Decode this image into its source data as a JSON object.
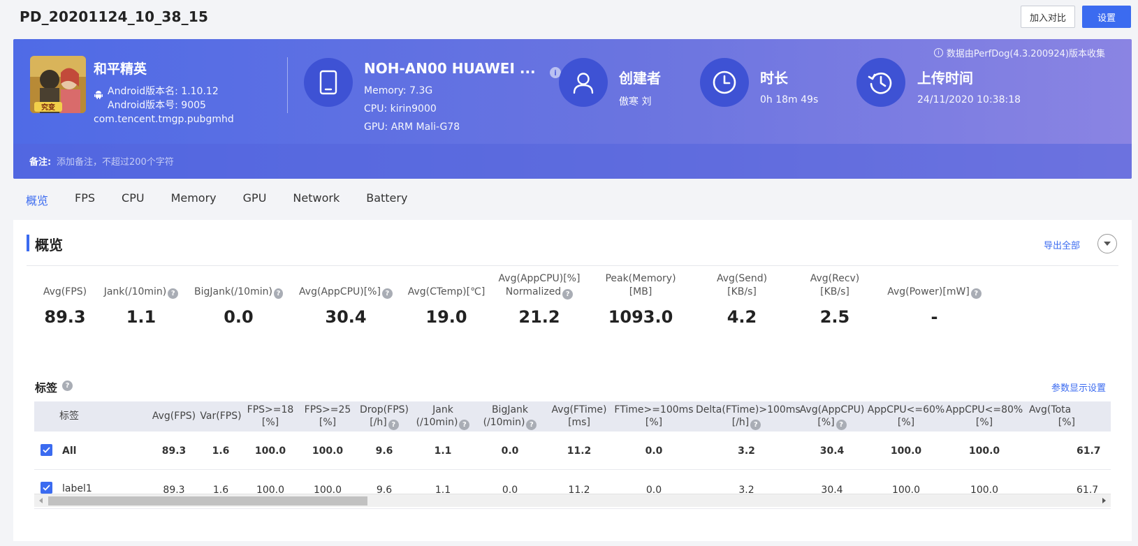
{
  "header": {
    "title": "PD_20201124_10_38_15",
    "compare_label": "加入对比",
    "settings_label": "设置"
  },
  "app": {
    "name": "和平精英",
    "version_name": "Android版本名: 1.10.12",
    "version_code": "Android版本号: 9005",
    "package": "com.tencent.tmgp.pubgmhd",
    "icon_text": "究变"
  },
  "device": {
    "name": "NOH-AN00 HUAWEI ...",
    "memory": "Memory: 7.3G",
    "cpu": "CPU: kirin9000",
    "gpu": "GPU: ARM Mali-G78",
    "info_glyph": "i"
  },
  "creator": {
    "title": "创建者",
    "value": "傲寒 刘"
  },
  "duration": {
    "title": "时长",
    "value": "0h 18m 49s"
  },
  "upload": {
    "title": "上传时间",
    "value": "24/11/2020 10:38:18"
  },
  "collect_note": "数据由PerfDog(4.3.200924)版本收集",
  "note": {
    "label": "备注:",
    "placeholder": "添加备注，不超过200个字符"
  },
  "tabs": [
    "概览",
    "FPS",
    "CPU",
    "Memory",
    "GPU",
    "Network",
    "Battery"
  ],
  "overview": {
    "title": "概览",
    "export_label": "导出全部",
    "help_glyph": "?",
    "metrics": [
      {
        "label": "Avg(FPS)",
        "value": "89.3",
        "help": false
      },
      {
        "label": "Jank(/10min)",
        "value": "1.1",
        "help": true
      },
      {
        "label": "BigJank(/10min)",
        "value": "0.0",
        "help": true
      },
      {
        "label": "Avg(AppCPU)[%]",
        "value": "30.4",
        "help": true
      },
      {
        "label": "Avg(CTemp)[℃]",
        "value": "19.0",
        "help": false
      },
      {
        "label": "Avg(AppCPU)[%]",
        "label2": "Normalized",
        "value": "21.2",
        "help": true
      },
      {
        "label": "Peak(Memory)[MB]",
        "value": "1093.0",
        "help": false
      },
      {
        "label": "Avg(Send)[KB/s]",
        "value": "4.2",
        "help": false
      },
      {
        "label": "Avg(Recv)[KB/s]",
        "value": "2.5",
        "help": false
      },
      {
        "label": "Avg(Power)[mW]",
        "value": "-",
        "help": true
      }
    ]
  },
  "tags": {
    "title": "标签",
    "param_settings_label": "参数显示设置",
    "columns": [
      {
        "l1": "标签"
      },
      {
        "l1": "Avg(FPS)"
      },
      {
        "l1": "Var(FPS)"
      },
      {
        "l1": "FPS>=18",
        "l2": "[%]"
      },
      {
        "l1": "FPS>=25",
        "l2": "[%]"
      },
      {
        "l1": "Drop(FPS)",
        "l2": "[/h]",
        "help": true
      },
      {
        "l1": "Jank",
        "l2": "(/10min)",
        "help": true
      },
      {
        "l1": "BigJank",
        "l2": "(/10min)",
        "help": true
      },
      {
        "l1": "Avg(FTime)",
        "l2": "[ms]"
      },
      {
        "l1": "FTime>=100ms",
        "l2": "[%]"
      },
      {
        "l1": "Delta(FTime)>100ms",
        "l2": "[/h]",
        "help": true
      },
      {
        "l1": "Avg(AppCPU)",
        "l2": "[%]",
        "help": true
      },
      {
        "l1": "AppCPU<=60%",
        "l2": "[%]"
      },
      {
        "l1": "AppCPU<=80%",
        "l2": "[%]"
      },
      {
        "l1": "Avg(Tota",
        "l2": "[%]"
      }
    ],
    "rows": [
      {
        "checked": true,
        "bold": true,
        "cells": [
          "All",
          "89.3",
          "1.6",
          "100.0",
          "100.0",
          "9.6",
          "1.1",
          "0.0",
          "11.2",
          "0.0",
          "3.2",
          "30.4",
          "100.0",
          "100.0",
          "61.7"
        ]
      },
      {
        "checked": true,
        "bold": false,
        "cells": [
          "label1",
          "89.3",
          "1.6",
          "100.0",
          "100.0",
          "9.6",
          "1.1",
          "0.0",
          "11.2",
          "0.0",
          "3.2",
          "30.4",
          "100.0",
          "100.0",
          "61.7"
        ]
      }
    ]
  },
  "colors": {
    "accent": "#3b6bf0",
    "banner_start": "#4f6be6",
    "banner_end": "#8a84e3",
    "circle": "#3e52d4"
  }
}
